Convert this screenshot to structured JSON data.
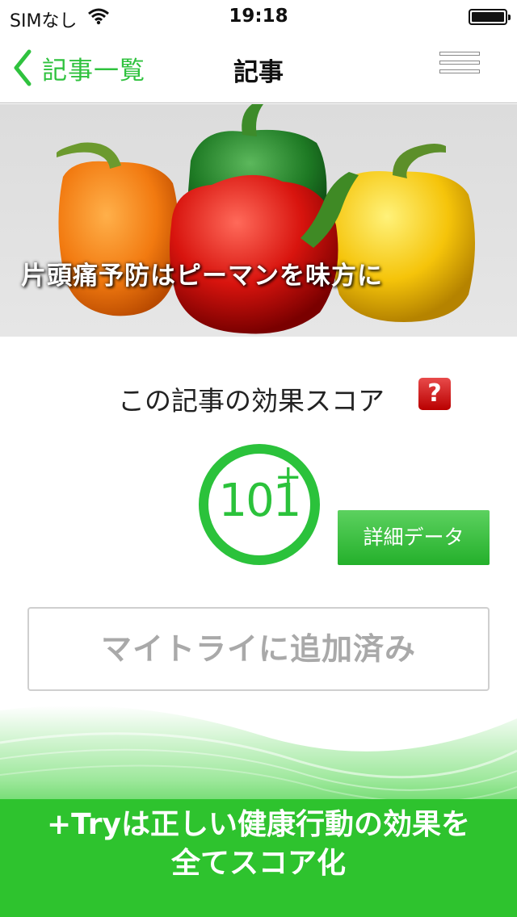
{
  "status_bar": {
    "carrier": "SIMなし",
    "time": "19:18"
  },
  "nav": {
    "back_label": "記事一覧",
    "title": "記事"
  },
  "hero": {
    "caption": "片頭痛予防はピーマンを味方に"
  },
  "score": {
    "label": "この記事の効果スコア",
    "help_symbol": "?",
    "value": "101",
    "plus_symbol": "+",
    "detail_button": "詳細データ"
  },
  "mytry": {
    "label": "マイトライに追加済み"
  },
  "banner": {
    "line1": "+Tryは正しい健康行動の効果を",
    "line2": "全てスコア化"
  },
  "colors": {
    "accent": "#2bc23b",
    "help_red": "#c40000"
  }
}
